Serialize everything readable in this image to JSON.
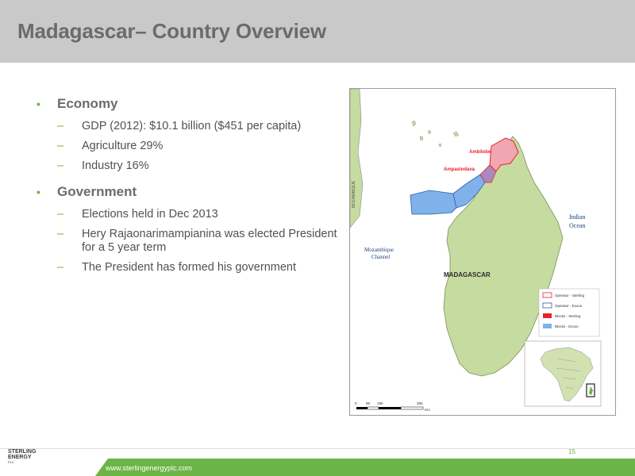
{
  "header": {
    "title": "Madagascar– Country Overview"
  },
  "sections": [
    {
      "heading": "Economy",
      "items": [
        "GDP (2012): $10.1 billion ($451 per capita)",
        "Agriculture 29%",
        "Industry 16%"
      ]
    },
    {
      "heading": "Government",
      "items": [
        "Elections held in Dec 2013",
        "Hery Rajaonarimampianina was elected President for a 5 year term",
        "The President has formed his government"
      ]
    }
  ],
  "map": {
    "country_label": "MADAGASCAR",
    "ocean_label_1": "Indian",
    "ocean_label_2": "Ocean",
    "channel_label_1": "Mozambique",
    "channel_label_2": "Channel",
    "side_label": "MOZAMBIQUE",
    "block_labels": [
      "Ambilobe",
      "Ampasindava"
    ],
    "legend": [
      {
        "label": "Operator - Sterling",
        "style": "outline",
        "color": "#e8232a"
      },
      {
        "label": "Operator - Exxon",
        "style": "outline",
        "color": "#2e5ea8"
      },
      {
        "label": "Blocks - Sterling",
        "style": "fill",
        "color": "#e8232a"
      },
      {
        "label": "Blocks - Exxon",
        "style": "fill",
        "color": "#7fb2ea"
      }
    ],
    "scale_labels": [
      "0",
      "95",
      "190",
      "380"
    ],
    "scale_unit": "Km",
    "colors": {
      "land": "#c6dba0",
      "africa": "#d1e2b0",
      "sea": "#ffffff"
    }
  },
  "footer": {
    "url": "www.sterlingenergyplc.com",
    "page_number": "15",
    "logo_line1": "STERLING",
    "logo_line2": "ENERGY",
    "logo_line3": "PLC",
    "accent_color": "#6bb445"
  }
}
